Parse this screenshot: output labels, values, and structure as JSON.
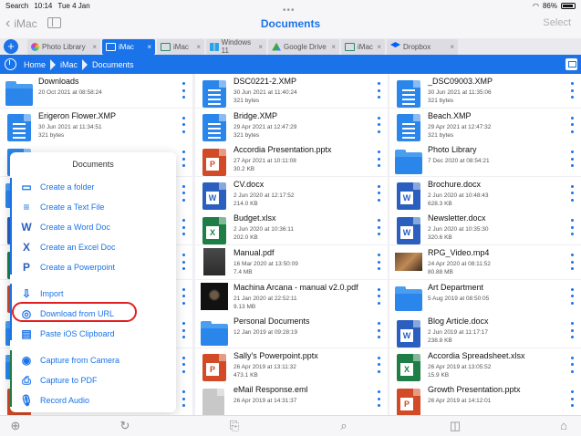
{
  "status": {
    "left": [
      "Search",
      "10:14",
      "Tue 4 Jan"
    ],
    "battery": "86%"
  },
  "nav": {
    "back_label": "iMac",
    "title": "Documents",
    "select_label": "Select"
  },
  "tabs": [
    {
      "label": "Photo Library",
      "icon": "photos-icon",
      "active": false
    },
    {
      "label": "iMac",
      "icon": "monitor-icon",
      "active": true
    },
    {
      "label": "iMac",
      "icon": "monitor-icon",
      "active": false
    },
    {
      "label": "Windows 11",
      "icon": "windows-icon",
      "active": false
    },
    {
      "label": "Google Drive",
      "icon": "google-drive-icon",
      "active": false
    },
    {
      "label": "iMac",
      "icon": "monitor-icon",
      "active": false
    },
    {
      "label": "Dropbox",
      "icon": "dropbox-icon",
      "active": false
    }
  ],
  "breadcrumbs": [
    "Home",
    "iMac",
    "Documents"
  ],
  "files": [
    [
      {
        "name": "Downloads",
        "date": "20 Oct 2021 at 08:58:24",
        "size": "",
        "kind": "folder"
      },
      {
        "name": "Erigeron Flower.XMP",
        "date": "30 Jun 2021 at 11:34:51",
        "size": "321 bytes",
        "kind": "xmp"
      },
      {
        "name": "",
        "date": "",
        "size": "",
        "kind": "xmp"
      },
      {
        "name": "",
        "date": "",
        "size": "",
        "kind": "folder"
      },
      {
        "name": "",
        "date": "",
        "size": "",
        "kind": "word"
      },
      {
        "name": "",
        "date": "",
        "size": "",
        "kind": "excel"
      },
      {
        "name": "",
        "date": "",
        "size": "",
        "kind": "ppt"
      },
      {
        "name": "",
        "date": "",
        "size": "",
        "kind": "folder"
      },
      {
        "name": "",
        "date": "",
        "size": "",
        "kind": "folder"
      },
      {
        "name": "",
        "date": "",
        "size": "",
        "kind": "ppt"
      }
    ],
    [
      {
        "name": "DSC0221-2.XMP",
        "date": "30 Jun 2021 at 11:40:24",
        "size": "321 bytes",
        "kind": "xmp"
      },
      {
        "name": "Bridge.XMP",
        "date": "29 Apr 2021 at 12:47:29",
        "size": "321 bytes",
        "kind": "xmp"
      },
      {
        "name": "Accordia Presentation.pptx",
        "date": "27 Apr 2021 at 10:11:08",
        "size": "30.2 KB",
        "kind": "ppt"
      },
      {
        "name": "CV.docx",
        "date": "2 Jun 2020 at 12:17:52",
        "size": "214.0 KB",
        "kind": "word"
      },
      {
        "name": "Budget.xlsx",
        "date": "2 Jun 2020 at 10:36:11",
        "size": "202.0 KB",
        "kind": "excel"
      },
      {
        "name": "Manual.pdf",
        "date": "16 Mar 2020 at 13:50:09",
        "size": "7.4 MB",
        "kind": "pdf-dark"
      },
      {
        "name": "Machina Arcana - manual v2.0.pdf",
        "date": "21 Jan 2020 at 22:52:11",
        "size": "9.13 MB",
        "kind": "pdf-black"
      },
      {
        "name": "Personal Documents",
        "date": "12 Jan 2019 at 09:28:19",
        "size": "",
        "kind": "folder"
      },
      {
        "name": "Sally's Powerpoint.pptx",
        "date": "26 Apr 2019 at 13:11:32",
        "size": "473.1 KB",
        "kind": "ppt"
      },
      {
        "name": "eMail Response.eml",
        "date": "26 Apr 2019 at 14:31:37",
        "size": "",
        "kind": "eml"
      }
    ],
    [
      {
        "name": "_DSC09003.XMP",
        "date": "30 Jun 2021 at 11:35:06",
        "size": "321 bytes",
        "kind": "xmp"
      },
      {
        "name": "Beach.XMP",
        "date": "29 Apr 2021 at 12:47:32",
        "size": "321 bytes",
        "kind": "xmp"
      },
      {
        "name": "Photo Library",
        "date": "7 Dec 2020 at 08:54:21",
        "size": "",
        "kind": "folder"
      },
      {
        "name": "Brochure.docx",
        "date": "2 Jun 2020 at 10:48:43",
        "size": "628.3 KB",
        "kind": "word"
      },
      {
        "name": "Newsletter.docx",
        "date": "2 Jun 2020 at 10:35:30",
        "size": "320.6 KB",
        "kind": "word"
      },
      {
        "name": "RPG_Video.mp4",
        "date": "24 Apr 2020 at 08:11:52",
        "size": "80.88 MB",
        "kind": "video"
      },
      {
        "name": "Art Department",
        "date": "5 Aug 2019 at 08:50:05",
        "size": "",
        "kind": "folder"
      },
      {
        "name": "Blog Article.docx",
        "date": "2 Jun 2019 at 11:17:17",
        "size": "238.8 KB",
        "kind": "word"
      },
      {
        "name": "Accordia Spreadsheet.xlsx",
        "date": "26 Apr 2019 at 13:05:52",
        "size": "15.9 KB",
        "kind": "excel"
      },
      {
        "name": "Growth Presentation.pptx",
        "date": "26 Apr 2019 at 14:12:01",
        "size": "",
        "kind": "ppt"
      }
    ]
  ],
  "menu": {
    "title": "Documents",
    "groups": [
      [
        {
          "label": "Create a folder",
          "icon": "folder-icon"
        },
        {
          "label": "Create a Text File",
          "icon": "text-file-icon"
        },
        {
          "label": "Create a Word Doc",
          "icon": "word-icon"
        },
        {
          "label": "Create an Excel Doc",
          "icon": "excel-icon"
        },
        {
          "label": "Create a Powerpoint",
          "icon": "powerpoint-icon"
        }
      ],
      [
        {
          "label": "Import",
          "icon": "import-icon"
        },
        {
          "label": "Download from URL",
          "icon": "globe-icon"
        },
        {
          "label": "Paste iOS Clipboard",
          "icon": "clipboard-icon"
        }
      ],
      [
        {
          "label": "Capture from Camera",
          "icon": "camera-icon"
        },
        {
          "label": "Capture to PDF",
          "icon": "pdf-capture-icon"
        },
        {
          "label": "Record Audio",
          "icon": "microphone-icon"
        }
      ]
    ]
  },
  "colors": {
    "accent": "#1a73e8",
    "highlight": "#e02020",
    "word": "#2b5fbf",
    "excel": "#1e7e45",
    "ppt": "#d24a26"
  }
}
